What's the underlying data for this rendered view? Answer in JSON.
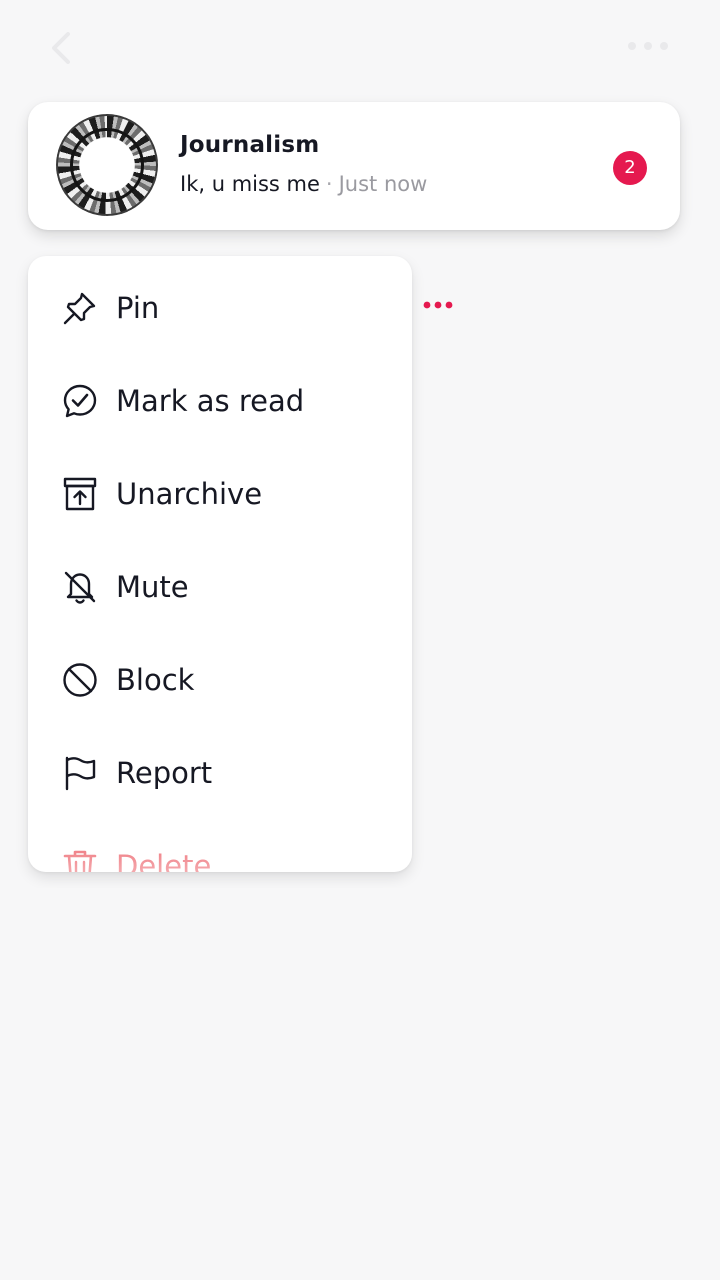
{
  "topbar": {
    "back_icon": "chevron-left-icon",
    "more_icon": "more-horizontal-icon"
  },
  "conversation": {
    "name": "Journalism",
    "last_message": "Ik, u miss me",
    "separator": "·",
    "time": "Just now",
    "unread_count": "2",
    "badge_color": "#e5194f"
  },
  "context_menu": {
    "items": [
      {
        "label": "Pin",
        "icon": "pin-icon"
      },
      {
        "label": "Mark as read",
        "icon": "mark-read-icon"
      },
      {
        "label": "Unarchive",
        "icon": "unarchive-icon"
      },
      {
        "label": "Mute",
        "icon": "bell-off-icon"
      },
      {
        "label": "Block",
        "icon": "block-icon"
      },
      {
        "label": "Report",
        "icon": "flag-icon"
      },
      {
        "label": "Delete",
        "icon": "trash-icon",
        "color": "#e8404a"
      }
    ]
  },
  "colors": {
    "accent": "#e5194f",
    "danger": "#e8404a",
    "text": "#161823",
    "muted": "#9a9aa0"
  }
}
